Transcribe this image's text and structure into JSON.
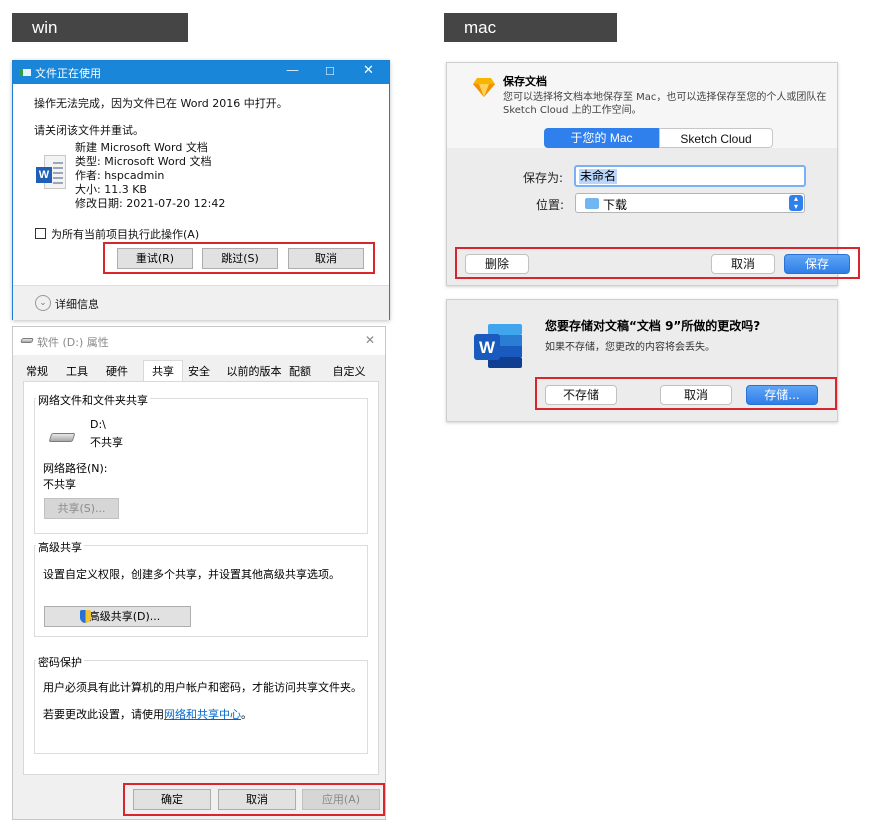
{
  "labels": {
    "win": "win",
    "mac": "mac"
  },
  "win_file_in_use": {
    "title": "文件正在使用",
    "title_controls": {
      "minimize": "—",
      "maximize": "☐",
      "close": "✕"
    },
    "message": "操作无法完成，因为文件已在 Word 2016 中打开。",
    "instruction": "请关闭该文件并重试。",
    "file": {
      "icon": "word-file-icon",
      "name": "新建 Microsoft Word 文档",
      "type": "类型: Microsoft Word 文档",
      "author": "作者: hspcadmin",
      "size": "大小: 11.3 KB",
      "modified": "修改日期: 2021-07-20 12:42"
    },
    "checkbox_label": "为所有当前项目执行此操作(A)",
    "buttons": {
      "retry": "重试(R)",
      "skip": "跳过(S)",
      "cancel": "取消"
    },
    "details": "详细信息"
  },
  "win_properties": {
    "title": "软件 (D:) 属性",
    "close": "✕",
    "tabs": [
      "常规",
      "工具",
      "硬件",
      "共享",
      "安全",
      "以前的版本",
      "配额",
      "自定义"
    ],
    "active_tab": "共享",
    "network_sharing": {
      "title": "网络文件和文件夹共享",
      "drive_name": "D:\\",
      "drive_status": "不共享",
      "path_label": "网络路径(N):",
      "path_value": "不共享",
      "share_button": "共享(S)..."
    },
    "advanced_sharing": {
      "title": "高级共享",
      "description": "设置自定义权限，创建多个共享，并设置其他高级共享选项。",
      "button": "高级共享(D)..."
    },
    "password_protection": {
      "title": "密码保护",
      "description": "用户必须具有此计算机的用户帐户和密码，才能访问共享文件夹。",
      "change_prefix": "若要更改此设置，请使用",
      "change_link": "网络和共享中心",
      "change_suffix": "。"
    },
    "buttons": {
      "ok": "确定",
      "cancel": "取消",
      "apply": "应用(A)"
    }
  },
  "mac_save": {
    "title": "保存文档",
    "description_line1": "您可以选择将文档本地保存至 Mac，也可以选择保存至您的个人或团队在",
    "description_line2": "Sketch Cloud 上的工作空间。",
    "segments": [
      "于您的 Mac",
      "Sketch Cloud"
    ],
    "save_as_label": "保存为:",
    "save_as_value": "未命名",
    "location_label": "位置:",
    "location_value": "下载",
    "buttons": {
      "delete": "删除",
      "cancel": "取消",
      "save": "保存"
    }
  },
  "mac_word": {
    "title": "您要存储对文稿“文档 9”所做的更改吗?",
    "message": "如果不存储，您更改的内容将会丢失。",
    "buttons": {
      "dont_save": "不存储",
      "cancel": "取消",
      "save": "存储..."
    }
  },
  "colors": {
    "win_blue": "#1a86d9",
    "highlight_red": "#d9252b",
    "mac_blue": "#2f7ee8",
    "link_blue": "#0066cc"
  }
}
